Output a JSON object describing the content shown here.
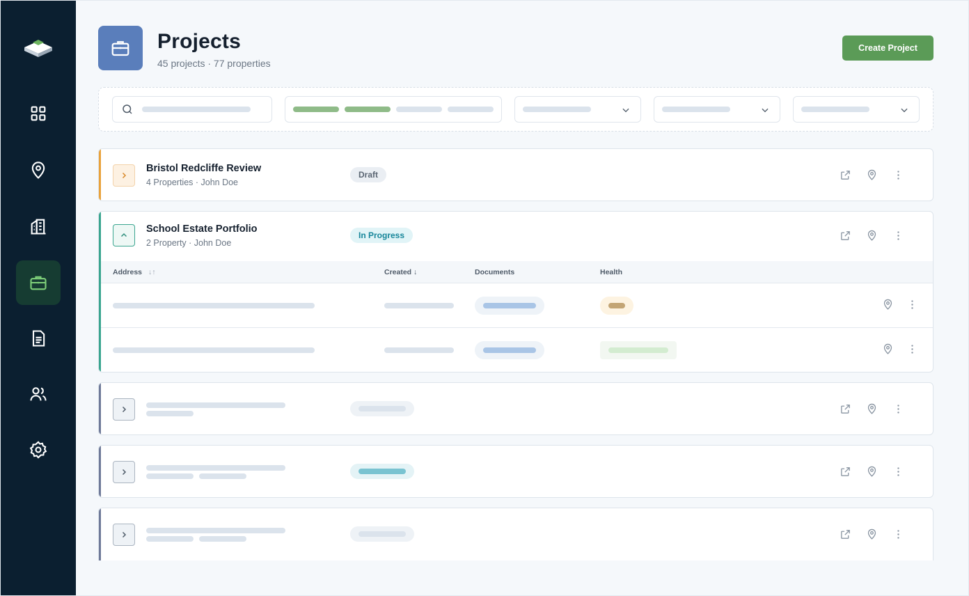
{
  "header": {
    "title": "Projects",
    "subtitle": "45 projects · 77 properties",
    "create_label": "Create Project"
  },
  "sidebar": {
    "items": [
      {
        "name": "dashboard",
        "icon": "grid-icon",
        "active": false
      },
      {
        "name": "locations",
        "icon": "map-pin-icon",
        "active": false
      },
      {
        "name": "buildings",
        "icon": "building-icon",
        "active": false
      },
      {
        "name": "projects",
        "icon": "briefcase-icon",
        "active": true
      },
      {
        "name": "documents",
        "icon": "document-icon",
        "active": false
      },
      {
        "name": "users",
        "icon": "users-icon",
        "active": false
      },
      {
        "name": "settings",
        "icon": "gear-icon",
        "active": false
      }
    ]
  },
  "projects": [
    {
      "name": "Bristol Redcliffe Review",
      "meta": "4 Properties · John Doe",
      "status": "Draft",
      "accent": "#e9a23b",
      "expanded": false
    },
    {
      "name": "School Estate Portfolio",
      "meta": "2 Property · John Doe",
      "status": "In Progress",
      "accent": "#3aa58f",
      "expanded": true
    }
  ],
  "table": {
    "columns": [
      "Address",
      "Created",
      "Documents",
      "Health"
    ],
    "sort_address": "↓↑",
    "sort_created": "↓"
  },
  "colors": {
    "sidebar_bg": "#0b1f30",
    "brand_green": "#5b9b57",
    "header_icon_bg": "#5a7ebb",
    "draft_accent": "#e9a23b",
    "in_progress_accent": "#3aa58f",
    "placeholder_accent": "#6f7a99"
  }
}
